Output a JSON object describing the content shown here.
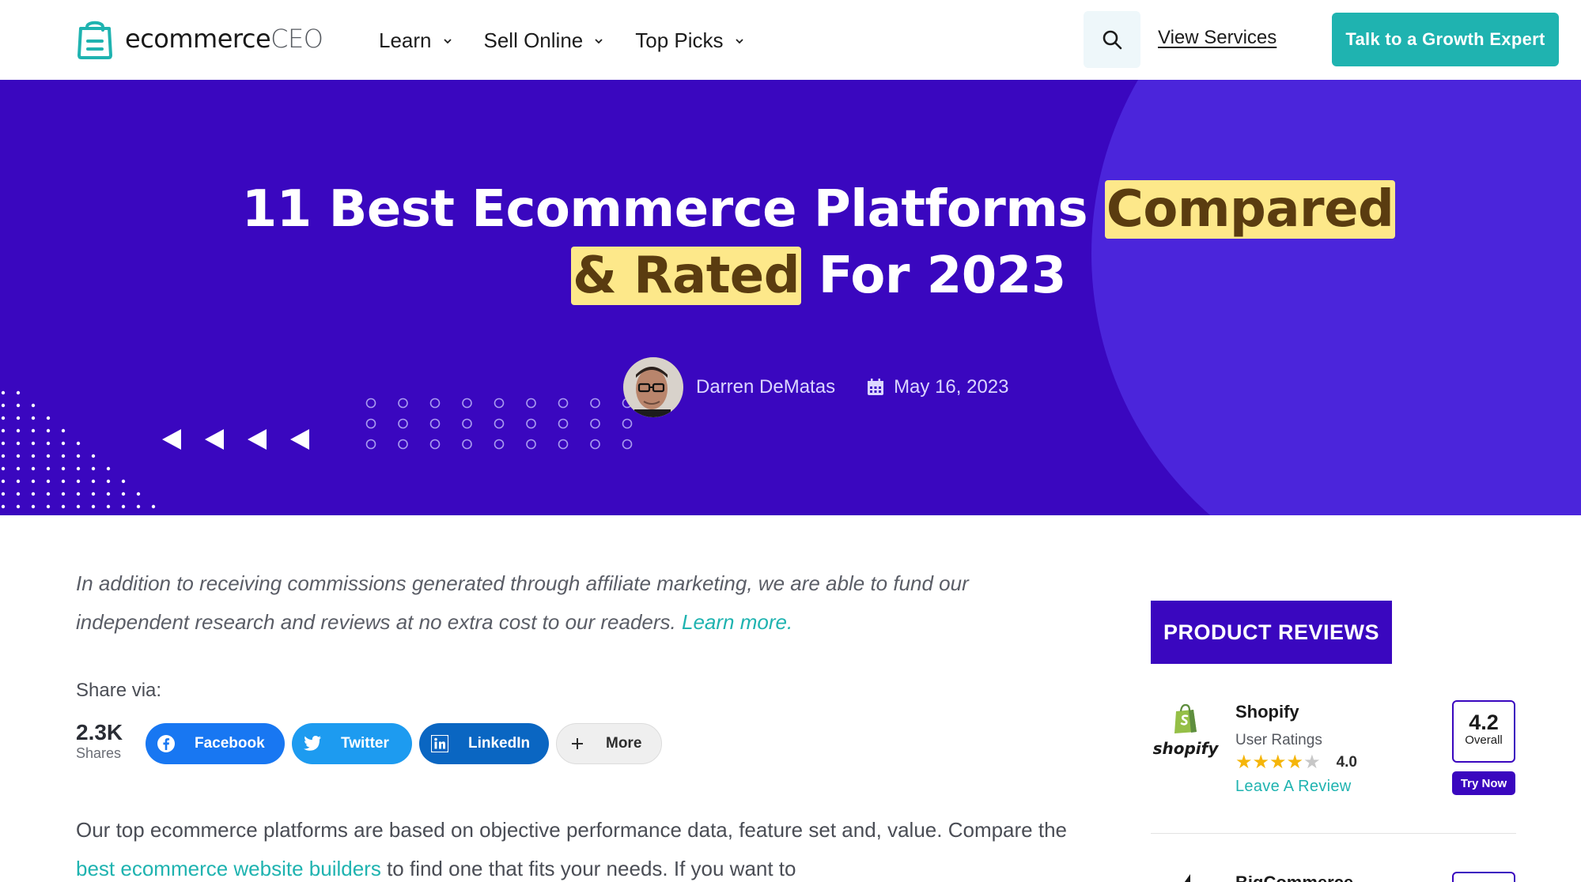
{
  "header": {
    "logo": {
      "primary": "ecommerce",
      "secondary": "CEO"
    },
    "nav": [
      {
        "label": "Learn"
      },
      {
        "label": "Sell Online"
      },
      {
        "label": "Top Picks"
      }
    ],
    "view_services": "View Services",
    "cta": "Talk to a Growth Expert"
  },
  "hero": {
    "title_part1": "11 Best Ecommerce Platforms ",
    "title_highlight1": "Compared",
    "title_highlight2": "& Rated",
    "title_part2": " For 2023",
    "author": "Darren DeMatas",
    "date": "May 16, 2023"
  },
  "content": {
    "disclaimer": "In addition to receiving commissions generated through affiliate marketing, we are able to fund our independent research and reviews at no extra cost to our readers.",
    "disclaimer_link": "Learn more.",
    "share_label": "Share via:",
    "share_count": "2.3K",
    "share_count_label": "Shares",
    "share_buttons": {
      "facebook": "Facebook",
      "twitter": "Twitter",
      "linkedin": "LinkedIn",
      "more": "More"
    },
    "body_part1": "Our top ecommerce platforms are based on objective performance data, feature set and, value. Compare the ",
    "body_link": "best ecommerce website builders",
    "body_part2": " to find one that fits your needs. If you want to"
  },
  "sidebar": {
    "title": "PRODUCT REVIEWS",
    "products": [
      {
        "name": "Shopify",
        "logo_word": "shopify",
        "ratings_label": "User Ratings",
        "stars": 4,
        "score": "4.0",
        "leave_review": "Leave A Review",
        "overall_score": "4.2",
        "overall_label": "Overall",
        "try_label": "Try Now"
      },
      {
        "name": "BigCommerce"
      }
    ]
  },
  "colors": {
    "brand_purple": "#3a07bf",
    "teal": "#1fb3b0",
    "highlight": "#fde88a"
  }
}
